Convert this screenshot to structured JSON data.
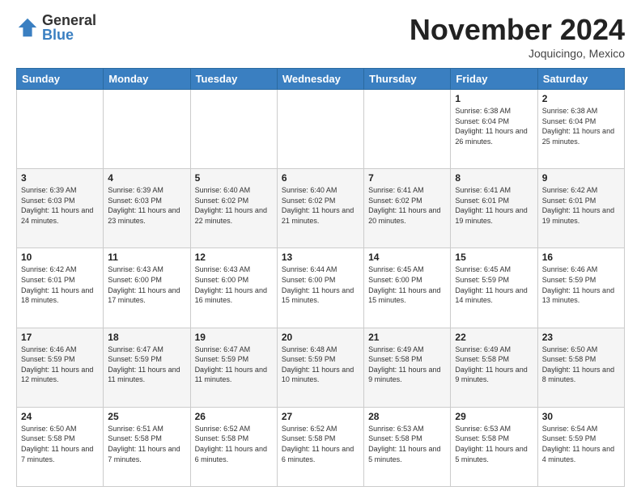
{
  "logo": {
    "general": "General",
    "blue": "Blue"
  },
  "title": "November 2024",
  "location": "Joquicingo, Mexico",
  "days_header": [
    "Sunday",
    "Monday",
    "Tuesday",
    "Wednesday",
    "Thursday",
    "Friday",
    "Saturday"
  ],
  "weeks": [
    [
      {
        "day": "",
        "info": ""
      },
      {
        "day": "",
        "info": ""
      },
      {
        "day": "",
        "info": ""
      },
      {
        "day": "",
        "info": ""
      },
      {
        "day": "",
        "info": ""
      },
      {
        "day": "1",
        "info": "Sunrise: 6:38 AM\nSunset: 6:04 PM\nDaylight: 11 hours and 26 minutes."
      },
      {
        "day": "2",
        "info": "Sunrise: 6:38 AM\nSunset: 6:04 PM\nDaylight: 11 hours and 25 minutes."
      }
    ],
    [
      {
        "day": "3",
        "info": "Sunrise: 6:39 AM\nSunset: 6:03 PM\nDaylight: 11 hours and 24 minutes."
      },
      {
        "day": "4",
        "info": "Sunrise: 6:39 AM\nSunset: 6:03 PM\nDaylight: 11 hours and 23 minutes."
      },
      {
        "day": "5",
        "info": "Sunrise: 6:40 AM\nSunset: 6:02 PM\nDaylight: 11 hours and 22 minutes."
      },
      {
        "day": "6",
        "info": "Sunrise: 6:40 AM\nSunset: 6:02 PM\nDaylight: 11 hours and 21 minutes."
      },
      {
        "day": "7",
        "info": "Sunrise: 6:41 AM\nSunset: 6:02 PM\nDaylight: 11 hours and 20 minutes."
      },
      {
        "day": "8",
        "info": "Sunrise: 6:41 AM\nSunset: 6:01 PM\nDaylight: 11 hours and 19 minutes."
      },
      {
        "day": "9",
        "info": "Sunrise: 6:42 AM\nSunset: 6:01 PM\nDaylight: 11 hours and 19 minutes."
      }
    ],
    [
      {
        "day": "10",
        "info": "Sunrise: 6:42 AM\nSunset: 6:01 PM\nDaylight: 11 hours and 18 minutes."
      },
      {
        "day": "11",
        "info": "Sunrise: 6:43 AM\nSunset: 6:00 PM\nDaylight: 11 hours and 17 minutes."
      },
      {
        "day": "12",
        "info": "Sunrise: 6:43 AM\nSunset: 6:00 PM\nDaylight: 11 hours and 16 minutes."
      },
      {
        "day": "13",
        "info": "Sunrise: 6:44 AM\nSunset: 6:00 PM\nDaylight: 11 hours and 15 minutes."
      },
      {
        "day": "14",
        "info": "Sunrise: 6:45 AM\nSunset: 6:00 PM\nDaylight: 11 hours and 15 minutes."
      },
      {
        "day": "15",
        "info": "Sunrise: 6:45 AM\nSunset: 5:59 PM\nDaylight: 11 hours and 14 minutes."
      },
      {
        "day": "16",
        "info": "Sunrise: 6:46 AM\nSunset: 5:59 PM\nDaylight: 11 hours and 13 minutes."
      }
    ],
    [
      {
        "day": "17",
        "info": "Sunrise: 6:46 AM\nSunset: 5:59 PM\nDaylight: 11 hours and 12 minutes."
      },
      {
        "day": "18",
        "info": "Sunrise: 6:47 AM\nSunset: 5:59 PM\nDaylight: 11 hours and 11 minutes."
      },
      {
        "day": "19",
        "info": "Sunrise: 6:47 AM\nSunset: 5:59 PM\nDaylight: 11 hours and 11 minutes."
      },
      {
        "day": "20",
        "info": "Sunrise: 6:48 AM\nSunset: 5:59 PM\nDaylight: 11 hours and 10 minutes."
      },
      {
        "day": "21",
        "info": "Sunrise: 6:49 AM\nSunset: 5:58 PM\nDaylight: 11 hours and 9 minutes."
      },
      {
        "day": "22",
        "info": "Sunrise: 6:49 AM\nSunset: 5:58 PM\nDaylight: 11 hours and 9 minutes."
      },
      {
        "day": "23",
        "info": "Sunrise: 6:50 AM\nSunset: 5:58 PM\nDaylight: 11 hours and 8 minutes."
      }
    ],
    [
      {
        "day": "24",
        "info": "Sunrise: 6:50 AM\nSunset: 5:58 PM\nDaylight: 11 hours and 7 minutes."
      },
      {
        "day": "25",
        "info": "Sunrise: 6:51 AM\nSunset: 5:58 PM\nDaylight: 11 hours and 7 minutes."
      },
      {
        "day": "26",
        "info": "Sunrise: 6:52 AM\nSunset: 5:58 PM\nDaylight: 11 hours and 6 minutes."
      },
      {
        "day": "27",
        "info": "Sunrise: 6:52 AM\nSunset: 5:58 PM\nDaylight: 11 hours and 6 minutes."
      },
      {
        "day": "28",
        "info": "Sunrise: 6:53 AM\nSunset: 5:58 PM\nDaylight: 11 hours and 5 minutes."
      },
      {
        "day": "29",
        "info": "Sunrise: 6:53 AM\nSunset: 5:58 PM\nDaylight: 11 hours and 5 minutes."
      },
      {
        "day": "30",
        "info": "Sunrise: 6:54 AM\nSunset: 5:59 PM\nDaylight: 11 hours and 4 minutes."
      }
    ]
  ]
}
